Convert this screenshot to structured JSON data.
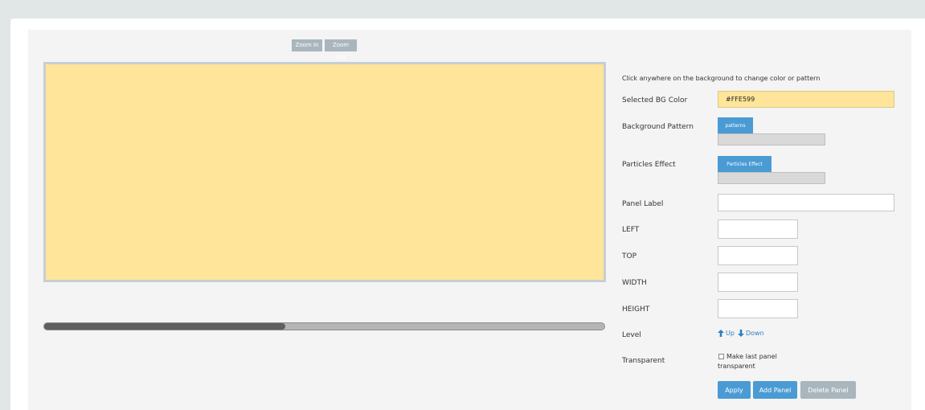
{
  "zoom": {
    "zoom_in_label": "Zoom In",
    "zoom_out_label": "Zoom Out"
  },
  "canvas": {
    "background_color": "#FFE599"
  },
  "scrollbar": {
    "position_fraction": 0.43
  },
  "settings": {
    "instruction": "Click anywhere on the background to change color or pattern",
    "selected_bg_color_label": "Selected BG Color",
    "selected_bg_color_value": "#FFE599",
    "background_pattern_label": "Background Pattern",
    "patterns_button_label": "patterns",
    "particles_effect_label": "Particles Effect",
    "particles_effect_button_label": "Particles Effect",
    "panel_label_label": "Panel Label",
    "panel_label_value": "",
    "left_label": "LEFT",
    "left_value": "",
    "top_label": "TOP",
    "top_value": "",
    "width_label": "WIDTH",
    "width_value": "",
    "height_label": "HEIGHT",
    "height_value": "",
    "level_label": "Level",
    "level_up_label": "Up",
    "level_down_label": "Down",
    "transparent_label": "Transparent",
    "transparent_checkbox_label": "Make last panel transparent"
  },
  "actions": {
    "apply_label": "Apply",
    "add_panel_label": "Add Panel",
    "delete_panel_label": "Delete Panel"
  },
  "colors": {
    "accent_blue": "#4A9BD4",
    "disabled_gray": "#A9B6BD",
    "link_blue": "#2D7FC1"
  },
  "icons": {
    "level_up": "arrow-up-icon",
    "level_down": "arrow-down-icon"
  }
}
